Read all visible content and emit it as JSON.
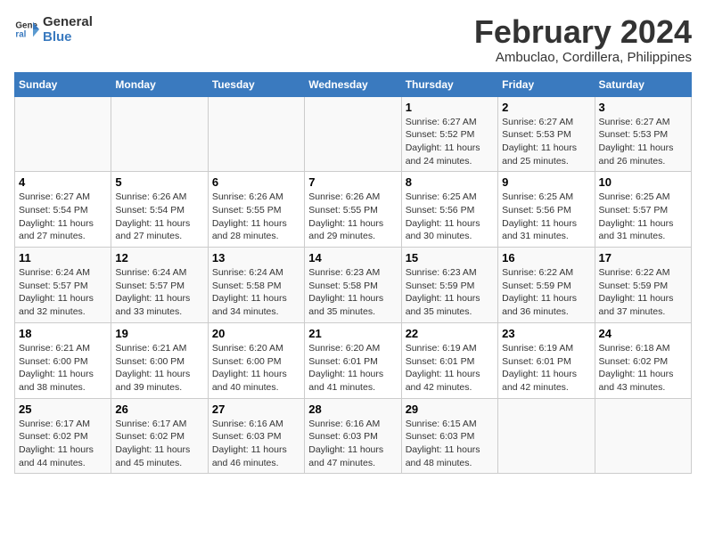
{
  "logo": {
    "line1": "General",
    "line2": "Blue"
  },
  "title": "February 2024",
  "location": "Ambuclao, Cordillera, Philippines",
  "days_of_week": [
    "Sunday",
    "Monday",
    "Tuesday",
    "Wednesday",
    "Thursday",
    "Friday",
    "Saturday"
  ],
  "weeks": [
    [
      {
        "day": "",
        "content": ""
      },
      {
        "day": "",
        "content": ""
      },
      {
        "day": "",
        "content": ""
      },
      {
        "day": "",
        "content": ""
      },
      {
        "day": "1",
        "content": "Sunrise: 6:27 AM\nSunset: 5:52 PM\nDaylight: 11 hours and 24 minutes."
      },
      {
        "day": "2",
        "content": "Sunrise: 6:27 AM\nSunset: 5:53 PM\nDaylight: 11 hours and 25 minutes."
      },
      {
        "day": "3",
        "content": "Sunrise: 6:27 AM\nSunset: 5:53 PM\nDaylight: 11 hours and 26 minutes."
      }
    ],
    [
      {
        "day": "4",
        "content": "Sunrise: 6:27 AM\nSunset: 5:54 PM\nDaylight: 11 hours and 27 minutes."
      },
      {
        "day": "5",
        "content": "Sunrise: 6:26 AM\nSunset: 5:54 PM\nDaylight: 11 hours and 27 minutes."
      },
      {
        "day": "6",
        "content": "Sunrise: 6:26 AM\nSunset: 5:55 PM\nDaylight: 11 hours and 28 minutes."
      },
      {
        "day": "7",
        "content": "Sunrise: 6:26 AM\nSunset: 5:55 PM\nDaylight: 11 hours and 29 minutes."
      },
      {
        "day": "8",
        "content": "Sunrise: 6:25 AM\nSunset: 5:56 PM\nDaylight: 11 hours and 30 minutes."
      },
      {
        "day": "9",
        "content": "Sunrise: 6:25 AM\nSunset: 5:56 PM\nDaylight: 11 hours and 31 minutes."
      },
      {
        "day": "10",
        "content": "Sunrise: 6:25 AM\nSunset: 5:57 PM\nDaylight: 11 hours and 31 minutes."
      }
    ],
    [
      {
        "day": "11",
        "content": "Sunrise: 6:24 AM\nSunset: 5:57 PM\nDaylight: 11 hours and 32 minutes."
      },
      {
        "day": "12",
        "content": "Sunrise: 6:24 AM\nSunset: 5:57 PM\nDaylight: 11 hours and 33 minutes."
      },
      {
        "day": "13",
        "content": "Sunrise: 6:24 AM\nSunset: 5:58 PM\nDaylight: 11 hours and 34 minutes."
      },
      {
        "day": "14",
        "content": "Sunrise: 6:23 AM\nSunset: 5:58 PM\nDaylight: 11 hours and 35 minutes."
      },
      {
        "day": "15",
        "content": "Sunrise: 6:23 AM\nSunset: 5:59 PM\nDaylight: 11 hours and 35 minutes."
      },
      {
        "day": "16",
        "content": "Sunrise: 6:22 AM\nSunset: 5:59 PM\nDaylight: 11 hours and 36 minutes."
      },
      {
        "day": "17",
        "content": "Sunrise: 6:22 AM\nSunset: 5:59 PM\nDaylight: 11 hours and 37 minutes."
      }
    ],
    [
      {
        "day": "18",
        "content": "Sunrise: 6:21 AM\nSunset: 6:00 PM\nDaylight: 11 hours and 38 minutes."
      },
      {
        "day": "19",
        "content": "Sunrise: 6:21 AM\nSunset: 6:00 PM\nDaylight: 11 hours and 39 minutes."
      },
      {
        "day": "20",
        "content": "Sunrise: 6:20 AM\nSunset: 6:00 PM\nDaylight: 11 hours and 40 minutes."
      },
      {
        "day": "21",
        "content": "Sunrise: 6:20 AM\nSunset: 6:01 PM\nDaylight: 11 hours and 41 minutes."
      },
      {
        "day": "22",
        "content": "Sunrise: 6:19 AM\nSunset: 6:01 PM\nDaylight: 11 hours and 42 minutes."
      },
      {
        "day": "23",
        "content": "Sunrise: 6:19 AM\nSunset: 6:01 PM\nDaylight: 11 hours and 42 minutes."
      },
      {
        "day": "24",
        "content": "Sunrise: 6:18 AM\nSunset: 6:02 PM\nDaylight: 11 hours and 43 minutes."
      }
    ],
    [
      {
        "day": "25",
        "content": "Sunrise: 6:17 AM\nSunset: 6:02 PM\nDaylight: 11 hours and 44 minutes."
      },
      {
        "day": "26",
        "content": "Sunrise: 6:17 AM\nSunset: 6:02 PM\nDaylight: 11 hours and 45 minutes."
      },
      {
        "day": "27",
        "content": "Sunrise: 6:16 AM\nSunset: 6:03 PM\nDaylight: 11 hours and 46 minutes."
      },
      {
        "day": "28",
        "content": "Sunrise: 6:16 AM\nSunset: 6:03 PM\nDaylight: 11 hours and 47 minutes."
      },
      {
        "day": "29",
        "content": "Sunrise: 6:15 AM\nSunset: 6:03 PM\nDaylight: 11 hours and 48 minutes."
      },
      {
        "day": "",
        "content": ""
      },
      {
        "day": "",
        "content": ""
      }
    ]
  ]
}
